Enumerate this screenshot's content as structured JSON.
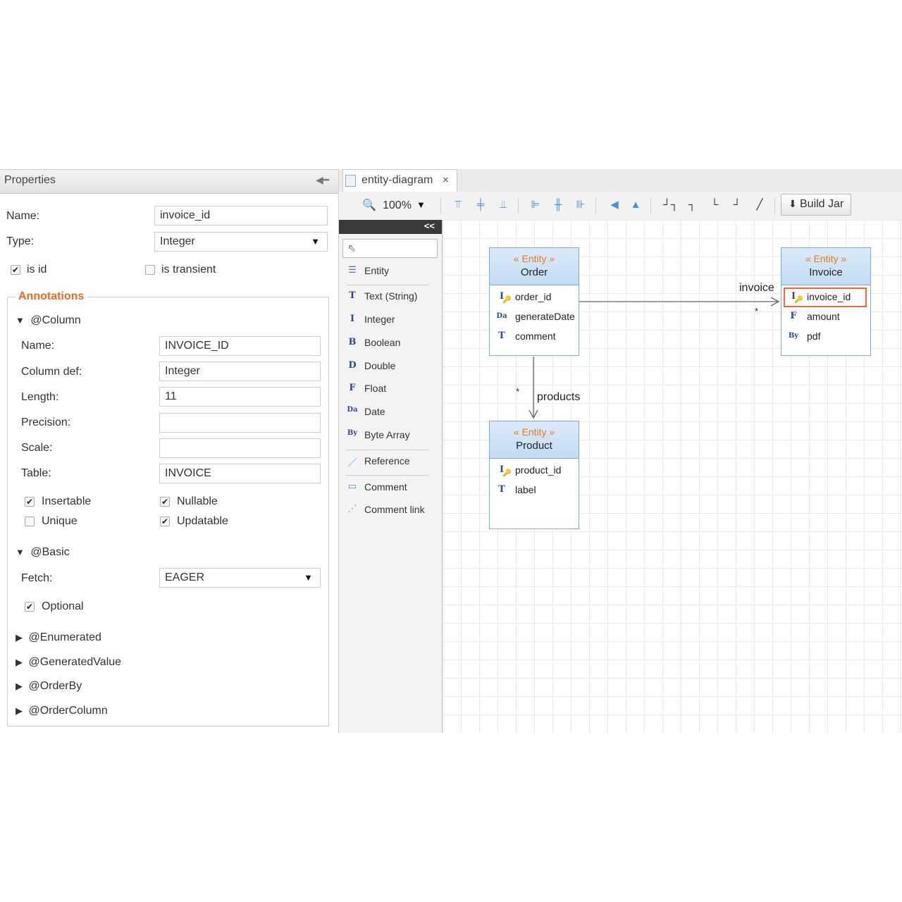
{
  "properties": {
    "title": "Properties",
    "name_label": "Name:",
    "name_value": "invoice_id",
    "type_label": "Type:",
    "type_value": "Integer",
    "is_id_label": "is id",
    "is_transient_label": "is transient",
    "annotations_title": "Annotations",
    "column": {
      "title": "@Column",
      "name_label": "Name:",
      "name_value": "INVOICE_ID",
      "coldef_label": "Column def:",
      "coldef_value": "Integer",
      "length_label": "Length:",
      "length_value": "11",
      "precision_label": "Precision:",
      "precision_value": "",
      "scale_label": "Scale:",
      "scale_value": "",
      "table_label": "Table:",
      "table_value": "INVOICE",
      "insertable_label": "Insertable",
      "nullable_label": "Nullable",
      "unique_label": "Unique",
      "updatable_label": "Updatable"
    },
    "basic": {
      "title": "@Basic",
      "fetch_label": "Fetch:",
      "fetch_value": "EAGER",
      "optional_label": "Optional"
    },
    "collapsed": [
      "@Enumerated",
      "@GeneratedValue",
      "@OrderBy",
      "@OrderColumn"
    ]
  },
  "editor": {
    "tab_label": "entity-diagram",
    "tab_close": "×",
    "zoom": "100%",
    "build_label": "Build Jar"
  },
  "palette": {
    "collapse": "<<",
    "items": [
      {
        "icon": "☰",
        "label": "Entity"
      },
      {
        "icon": "T",
        "label": "Text (String)"
      },
      {
        "icon": "I",
        "label": "Integer"
      },
      {
        "icon": "B",
        "label": "Boolean"
      },
      {
        "icon": "D",
        "label": "Double"
      },
      {
        "icon": "F",
        "label": "Float"
      },
      {
        "icon": "Da",
        "label": "Date"
      },
      {
        "icon": "By",
        "label": "Byte Array"
      },
      {
        "icon": "／",
        "label": "Reference"
      },
      {
        "icon": "▭",
        "label": "Comment"
      },
      {
        "icon": "⋰",
        "label": "Comment link"
      }
    ]
  },
  "diagram": {
    "stereotype": "« Entity »",
    "entities": {
      "order": {
        "name": "Order",
        "attrs": [
          {
            "icon": "I",
            "label": "order_id"
          },
          {
            "icon": "Da",
            "label": "generateDate"
          },
          {
            "icon": "T",
            "label": "comment"
          }
        ]
      },
      "invoice": {
        "name": "Invoice",
        "attrs": [
          {
            "icon": "I",
            "label": "invoice_id"
          },
          {
            "icon": "F",
            "label": "amount"
          },
          {
            "icon": "By",
            "label": "pdf"
          }
        ]
      },
      "product": {
        "name": "Product",
        "attrs": [
          {
            "icon": "I",
            "label": "product_id"
          },
          {
            "icon": "T",
            "label": "label"
          }
        ]
      }
    },
    "relations": {
      "invoice_label": "invoice",
      "invoice_mult": "*",
      "products_label": "products",
      "products_mult": "*"
    }
  }
}
